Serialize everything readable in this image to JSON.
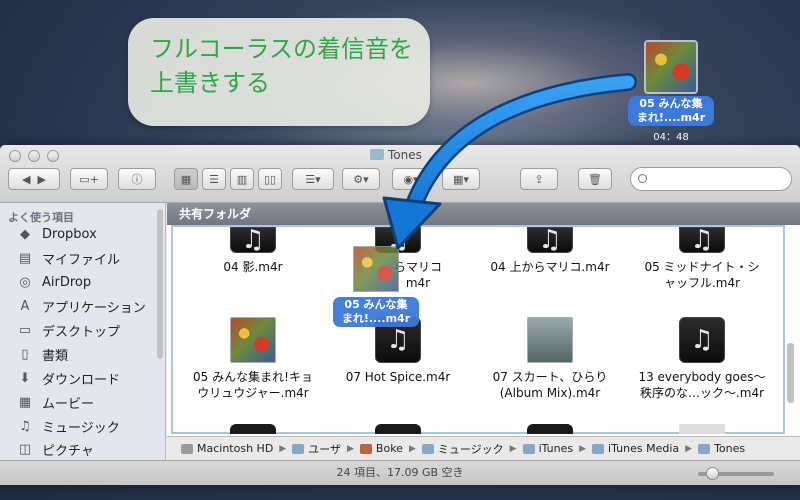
{
  "callout": {
    "line1": "フルコーラスの着信音を",
    "line2": "上書きする"
  },
  "desktop_item": {
    "label_line1": "05 みんな集",
    "label_line2": "まれ!....m4r",
    "duration": "04：48"
  },
  "window": {
    "title": "Tones",
    "search": {
      "placeholder": ""
    }
  },
  "toolbar": {
    "back_icon": "chevron-left-icon",
    "forward_icon": "chevron-right-icon",
    "view_modes": [
      "icon-view",
      "list-view",
      "column-view",
      "coverflow-view"
    ]
  },
  "sidebar": {
    "header": "よく使う項目",
    "items": [
      {
        "label": "Dropbox",
        "icon": "dropbox-icon"
      },
      {
        "label": "マイファイル",
        "icon": "all-files-icon"
      },
      {
        "label": "AirDrop",
        "icon": "airdrop-icon"
      },
      {
        "label": "アプリケーション",
        "icon": "applications-icon"
      },
      {
        "label": "デスクトップ",
        "icon": "desktop-icon"
      },
      {
        "label": "書類",
        "icon": "documents-icon"
      },
      {
        "label": "ダウンロード",
        "icon": "downloads-icon"
      },
      {
        "label": "ムービー",
        "icon": "movies-icon"
      },
      {
        "label": "ミュージック",
        "icon": "music-icon"
      },
      {
        "label": "ピクチャ",
        "icon": "pictures-icon"
      }
    ]
  },
  "section": {
    "title": "共有フォルダ"
  },
  "files": [
    {
      "name_line1": "04 影.m4r",
      "name_line2": ""
    },
    {
      "name_line1": "らマリコ",
      "name_line2": "m4r"
    },
    {
      "name_line1": "04 上からマリコ.m4r",
      "name_line2": ""
    },
    {
      "name_line1": "05 ミッドナイト・シ",
      "name_line2": "ャッフル.m4r"
    },
    {
      "name_line1": "05 みんな集まれ!キョ",
      "name_line2": "ウリュウジャー.m4r"
    },
    {
      "name_line1": "07 Hot Spice.m4r",
      "name_line2": ""
    },
    {
      "name_line1": "07 スカート、ひらり",
      "name_line2": "(Album Mix).m4r"
    },
    {
      "name_line1": "13 everybody goes～",
      "name_line2": "秩序のな…ック～.m4r"
    }
  ],
  "drag_item": {
    "label_line1": "05 みんな集",
    "label_line2": "まれ!....m4r"
  },
  "pathbar": {
    "crumbs": [
      "Macintosh HD",
      "ユーザ",
      "Boke",
      "ミュージック",
      "iTunes",
      "iTunes Media",
      "Tones"
    ]
  },
  "status": {
    "text": "24 項目、17.09 GB 空き"
  }
}
